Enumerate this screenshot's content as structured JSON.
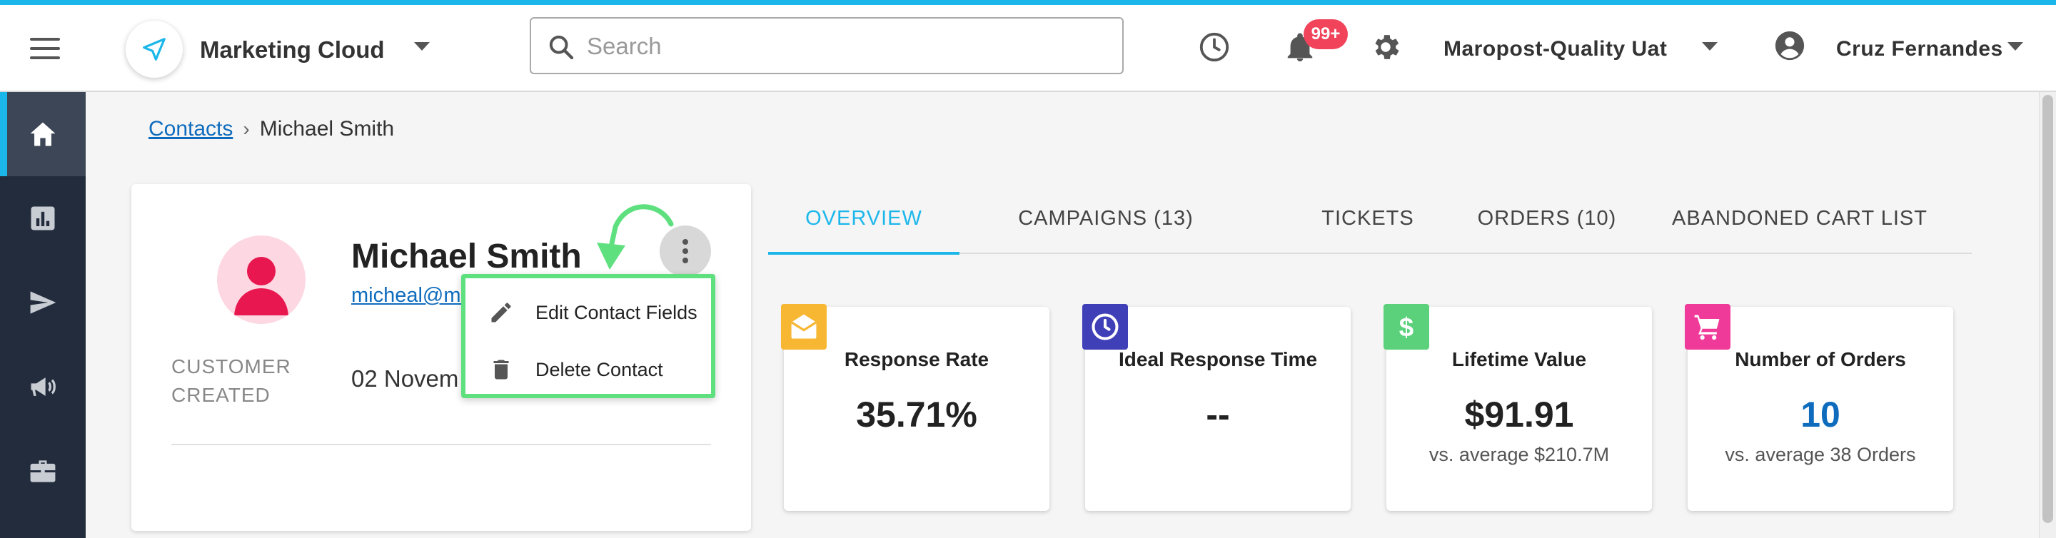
{
  "header": {
    "app_title": "Marketing Cloud",
    "search_placeholder": "Search",
    "notification_count": "99+",
    "org_name": "Maropost-Quality Uat",
    "user_name": "Cruz Fernandes"
  },
  "colors": {
    "accent": "#1cb7ea",
    "sidebar": "#222c3c",
    "badge": "#f1445b",
    "highlight": "#5ee07f",
    "link": "#0f6cbd"
  },
  "sidebar": {
    "items": [
      {
        "icon": "home-icon",
        "active": true
      },
      {
        "icon": "bar-chart-icon",
        "active": false
      },
      {
        "icon": "send-icon",
        "active": false
      },
      {
        "icon": "megaphone-icon",
        "active": false
      },
      {
        "icon": "briefcase-icon",
        "active": false
      }
    ]
  },
  "breadcrumb": {
    "parent": "Contacts",
    "current": "Michael Smith"
  },
  "contact": {
    "name": "Michael Smith",
    "email": "micheal@ma",
    "label_line1": "CUSTOMER",
    "label_line2": "CREATED",
    "created_value": "02 Novem"
  },
  "context_menu": {
    "items": [
      {
        "label": "Edit Contact Fields",
        "icon": "pencil-icon"
      },
      {
        "label": "Delete Contact",
        "icon": "trash-icon"
      }
    ]
  },
  "tabs": [
    {
      "label": "OVERVIEW",
      "active": true
    },
    {
      "label": "CAMPAIGNS  (13)",
      "active": false
    },
    {
      "label": "TICKETS",
      "active": false
    },
    {
      "label": "ORDERS  (10)",
      "active": false
    },
    {
      "label": "ABANDONED CART LIST",
      "active": false
    }
  ],
  "metrics": [
    {
      "title": "Response Rate",
      "value": "35.71%",
      "sub": "",
      "icon": "envelope-open-icon",
      "color": "#f7b733"
    },
    {
      "title": "Ideal Response Time",
      "value": "--",
      "sub": "",
      "icon": "clock-icon",
      "color": "#3f3fb8"
    },
    {
      "title": "Lifetime Value",
      "value": "$91.91",
      "sub": "vs. average $210.7M",
      "icon": "dollar-icon",
      "color": "#5ad17a"
    },
    {
      "title": "Number of Orders",
      "value": "10",
      "sub": "vs. average 38 Orders",
      "icon": "cart-icon",
      "color": "#f03a9a"
    }
  ]
}
